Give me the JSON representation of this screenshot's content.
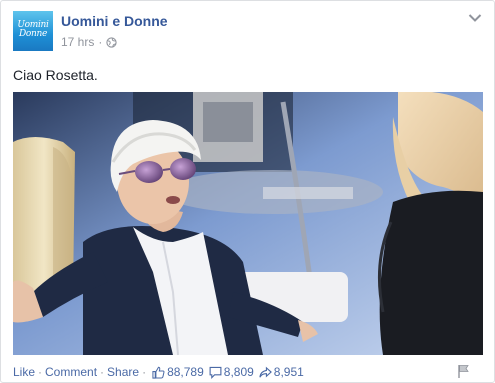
{
  "post": {
    "page_name": "Uomini e Donne",
    "logo_text_line1": "Uomini",
    "logo_text_line2": "Donne",
    "timestamp": "17 hrs",
    "separator": "·",
    "privacy_icon": "globe-icon",
    "menu_icon": "chevron-down-icon",
    "text": "Ciao Rosetta.",
    "image_alt": "Elderly woman with white hair and purple sunglasses gesturing on a TV studio set"
  },
  "footer": {
    "like_label": "Like",
    "comment_label": "Comment",
    "share_label": "Share",
    "separator": "·",
    "likes_count": "88,789",
    "comments_count": "8,809",
    "shares_count": "8,951",
    "like_icon": "thumbs-up-icon",
    "comment_icon": "comment-bubble-icon",
    "share_icon": "share-arrow-icon",
    "flag_icon": "flag-icon"
  },
  "colors": {
    "link": "#365899",
    "footer_link": "#4b6aa6",
    "muted": "#90949c",
    "border": "#dddfe2"
  }
}
